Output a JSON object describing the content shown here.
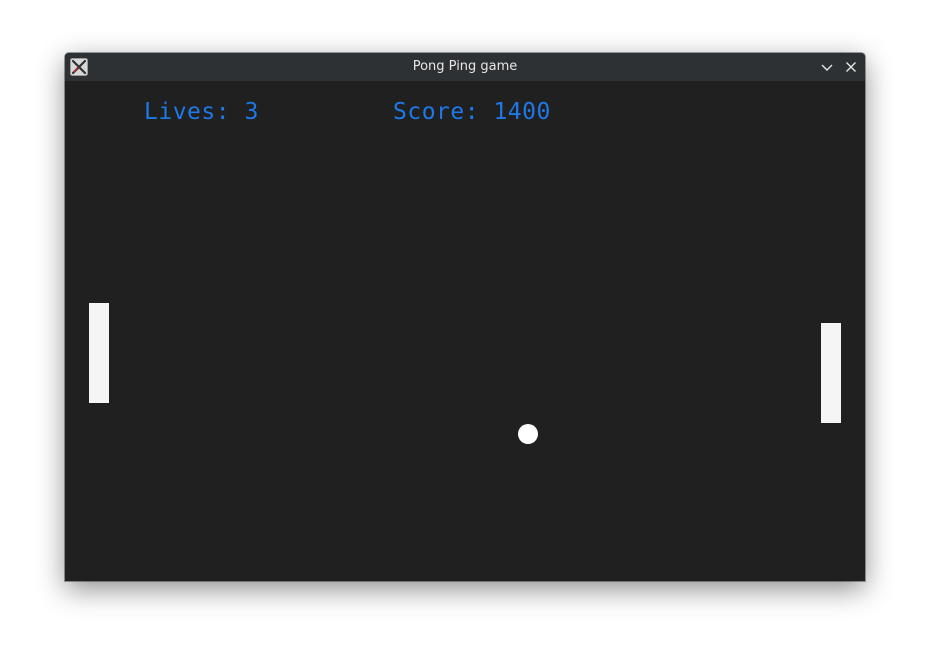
{
  "window": {
    "title": "Pong Ping game",
    "app_icon": "x11-app-icon",
    "controls": {
      "minimize_icon": "chevron-down-icon",
      "close_icon": "close-icon"
    }
  },
  "hud": {
    "lives_label": "Lives:",
    "lives_value": "3",
    "score_label": "Score:",
    "score_value": "1400"
  },
  "colors": {
    "background": "#202020",
    "titlebar": "#2e3134",
    "hud_text": "#1e78e6",
    "paddle": "#f5f5f5",
    "ball": "#ffffff"
  }
}
